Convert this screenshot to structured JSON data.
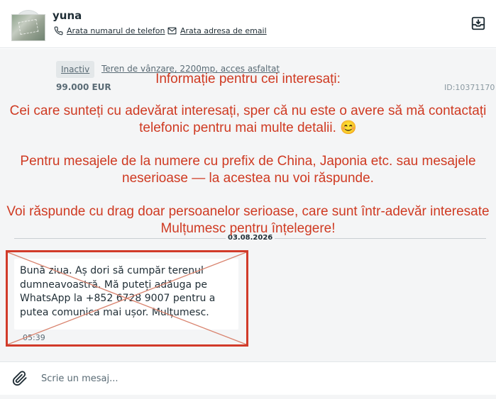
{
  "header": {
    "user_name": "yuna",
    "phone_link": "Arata numarul de telefon",
    "email_link": "Arata adresa de email",
    "icons": {
      "phone": "phone-icon",
      "email": "envelope-icon",
      "archive": "archive-box-icon",
      "avatar": "user-avatar-placeholder"
    }
  },
  "listing": {
    "status_badge": "Inactiv",
    "title": "Teren de vânzare, 2200mp, acces asfaltat",
    "price": "99.000 EUR",
    "id_label": "ID:10371170"
  },
  "overlay": {
    "title": "Informație pentru cei interesați:",
    "line1": "Cei care sunteți cu adevărat interesați, sper că nu este o avere să mă contactați",
    "line2": "telefonic pentru mai multe detalii. 😊",
    "line3": "Pentru mesajele de la numere cu prefix de China, Japonia etc. sau mesajele",
    "line4": "neserioase — la acestea nu voi răspunde.",
    "line5": "Voi răspunde cu drag doar persoanelor serioase, care sunt într-adevăr interesate",
    "line6": "Mulțumesc pentru înțelegere!",
    "color": "#cf3a22"
  },
  "chat": {
    "date": "03.08.2026",
    "message": {
      "text": "Bună ziua. Aș dori să cumpăr terenul dumneavoastră. Mă puteți adăuga pe WhatsApp la +852 6728 9007 pentru a putea comunica mai ușor. Mulțumesc.",
      "time": "05:39"
    },
    "highlight_color": "#d13b2a"
  },
  "composer": {
    "placeholder": "Scrie un mesaj...",
    "value": "",
    "icons": {
      "attach": "paperclip-icon"
    }
  }
}
